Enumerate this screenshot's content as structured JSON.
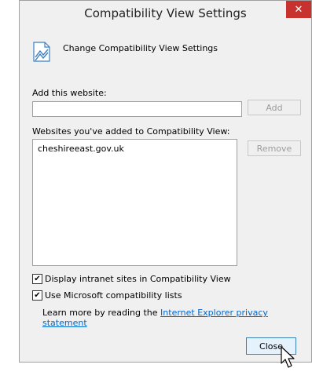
{
  "dialog": {
    "title": "Compatibility View Settings",
    "close_glyph": "✕"
  },
  "header": {
    "icon": "compatibility-view-icon",
    "text": "Change Compatibility View Settings"
  },
  "add_section": {
    "label": "Add this website:",
    "input_value": "",
    "add_button": "Add"
  },
  "list_section": {
    "label": "Websites you've added to Compatibility View:",
    "items": [
      "cheshireeast.gov.uk"
    ],
    "remove_button": "Remove"
  },
  "options": {
    "intranet": {
      "label": "Display intranet sites in Compatibility View",
      "checked": true
    },
    "ms_lists": {
      "label": "Use Microsoft compatibility lists",
      "checked": true
    }
  },
  "learn_more": {
    "prefix": "Learn more by reading the ",
    "link": "Internet Explorer privacy statement"
  },
  "footer": {
    "close_button": "Close"
  },
  "colors": {
    "close_x_bg": "#c7322f",
    "link": "#0066cc",
    "focus_border": "#3c7fb1"
  }
}
